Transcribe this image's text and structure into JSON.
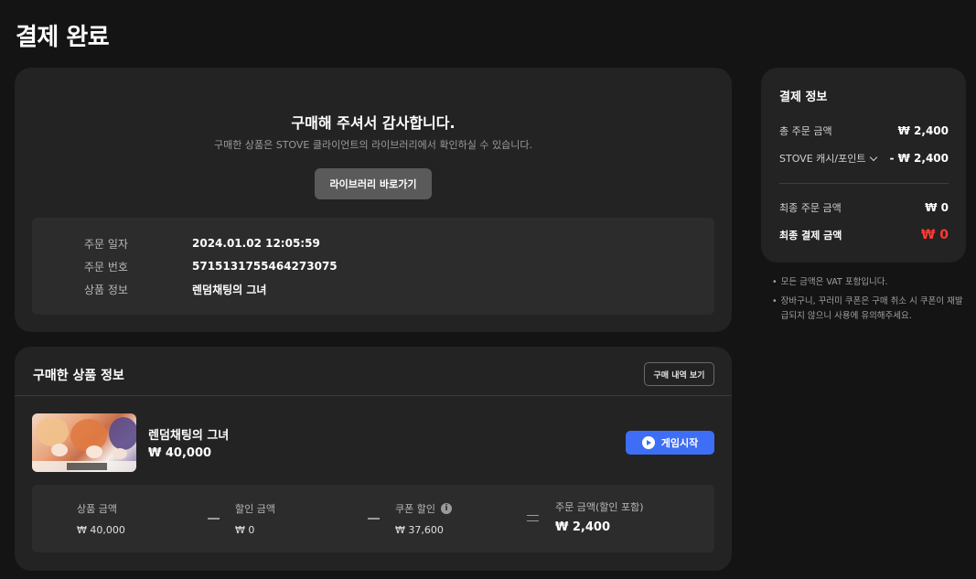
{
  "page": {
    "title": "결제 완료"
  },
  "thanks": {
    "title": "구매해 주셔서 감사합니다.",
    "subtitle": "구매한 상품은 STOVE 클라이언트의 라이브러리에서 확인하실 수 있습니다.",
    "library_button": "라이브러리 바로가기"
  },
  "order": {
    "date_label": "주문 일자",
    "date_value": "2024.01.02 12:05:59",
    "number_label": "주문 번호",
    "number_value": "5715131755464273075",
    "product_label": "상품 정보",
    "product_value": "렌덤채팅의 그녀"
  },
  "purchased": {
    "header": "구매한 상품 정보",
    "history_button": "구매 내역 보기",
    "game_title": "렌덤채팅의 그녀",
    "game_price": "₩ 40,000",
    "play_button": "게임시작",
    "breakdown": {
      "product_price_label": "상품 금액",
      "product_price_value": "₩ 40,000",
      "discount_label": "할인 금액",
      "discount_value": "₩ 0",
      "coupon_label": "쿠폰 할인",
      "coupon_value": "₩ 37,600",
      "order_total_label": "주문 금액(할인 포함)",
      "order_total_value": "₩ 2,400"
    }
  },
  "payment": {
    "title": "결제 정보",
    "total_order_label": "총 주문 금액",
    "total_order_value": "₩ 2,400",
    "cash_label": "STOVE 캐시/포인트",
    "cash_value": "- ₩ 2,400",
    "final_order_label": "최종 주문 금액",
    "final_order_value": "₩ 0",
    "final_payment_label": "최종 결제 금액",
    "final_payment_value": "₩ 0"
  },
  "notes": [
    "모든 금액은 VAT 포함입니다.",
    "장바구니, 꾸러미 쿠폰은 구매 취소 시 쿠폰이 재발급되지 않으니 사용에 유의해주세요."
  ],
  "colors": {
    "background": "#141414",
    "card": "#232323",
    "inner_box": "#2c2c2c",
    "primary_button": "#3d6ef5",
    "secondary_button": "#5a5a5a",
    "alert_red": "#ff3b30"
  }
}
